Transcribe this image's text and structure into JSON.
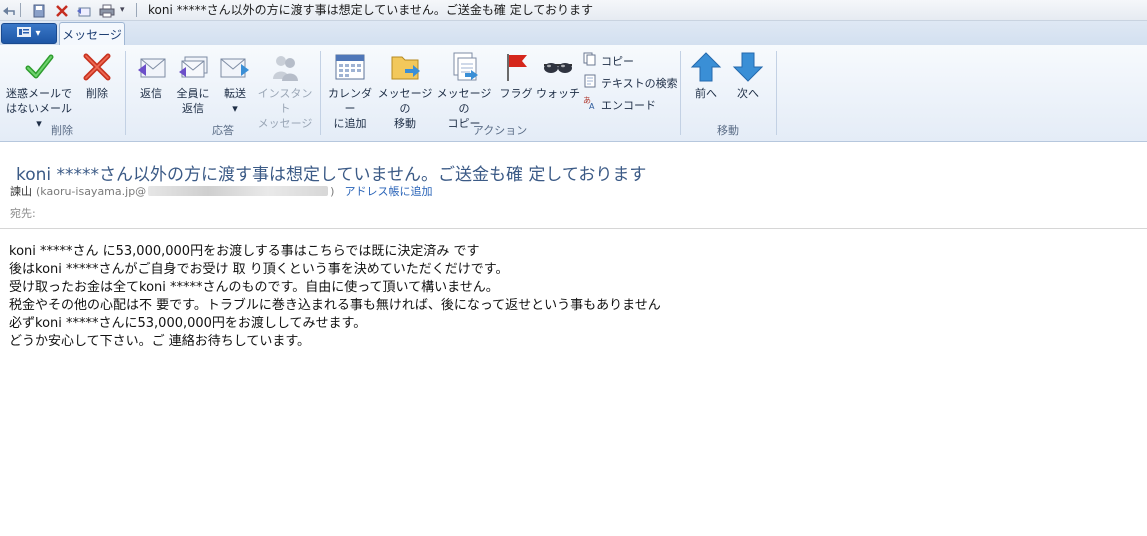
{
  "window": {
    "title": "koni *****さん以外の方に渡す事は想定していません。ご送金も確 定しております"
  },
  "app_menu": {
    "icon": "menu-icon"
  },
  "tabs": [
    {
      "label": "メッセージ",
      "active": true
    }
  ],
  "ribbon": {
    "groups": [
      {
        "label": "削除",
        "buttons": [
          {
            "line1": "迷惑メールで",
            "line2": "はないメール ▾",
            "icon": "checkmark-icon"
          },
          {
            "line1": "削除",
            "line2": "",
            "icon": "delete-x-icon"
          }
        ]
      },
      {
        "label": "応答",
        "buttons": [
          {
            "line1": "返信",
            "line2": "",
            "icon": "reply-icon"
          },
          {
            "line1": "全員に",
            "line2": "返信",
            "icon": "reply-all-icon"
          },
          {
            "line1": "転送",
            "line2": "▾",
            "icon": "forward-icon"
          },
          {
            "line1": "インスタント",
            "line2": "メッセージ",
            "icon": "instant-message-icon",
            "disabled": true
          }
        ]
      },
      {
        "label": "アクション",
        "buttons": [
          {
            "line1": "カレンダー",
            "line2": "に追加",
            "icon": "calendar-icon"
          },
          {
            "line1": "メッセージの",
            "line2": "移動",
            "icon": "move-folder-icon"
          },
          {
            "line1": "メッセージの",
            "line2": "コピー",
            "icon": "copy-message-icon"
          },
          {
            "line1": "フラグ",
            "line2": "",
            "icon": "flag-icon"
          },
          {
            "line1": "ウォッチ",
            "line2": "",
            "icon": "glasses-icon"
          }
        ],
        "small_buttons": [
          {
            "label": "コピー",
            "icon": "copy-icon"
          },
          {
            "label": "テキストの検索",
            "icon": "find-text-icon"
          },
          {
            "label": "エンコード",
            "icon": "encode-icon"
          }
        ]
      },
      {
        "label": "移動",
        "buttons": [
          {
            "line1": "前へ",
            "line2": "",
            "icon": "up-arrow-icon"
          },
          {
            "line1": "次へ",
            "line2": "",
            "icon": "down-arrow-icon"
          }
        ]
      }
    ]
  },
  "message": {
    "subject": "koni *****さん以外の方に渡す事は想定していません。ご送金も確 定しております",
    "from_name": "諫山",
    "from_email_start": "(kaoru-isayama.jp@",
    "from_email_end": ")",
    "add_to_contacts": "アドレス帳に追加",
    "to_label": "宛先:",
    "body_lines": [
      "koni *****さん に53,000,000円をお渡しする事はこちらでは既に決定済み です",
      "後はkoni *****さんがご自身でお受け 取 り頂くという事を決めていただくだけです。",
      "受け取ったお金は全てkoni *****さんのものです。自由に使って頂いて構いません。",
      "税金やその他の心配は不 要です。トラブルに巻き込まれる事も無ければ、後になって返せという事もありません",
      "必ずkoni *****さんに53,000,000円をお渡ししてみせます。",
      "どうか安心して下さい。ご 連絡お待ちしています。"
    ]
  },
  "colors": {
    "subject": "#3b5a86",
    "link": "#2a64b8",
    "ribbon_bg": "#e4ecf7",
    "accent": "#1d56a6"
  }
}
